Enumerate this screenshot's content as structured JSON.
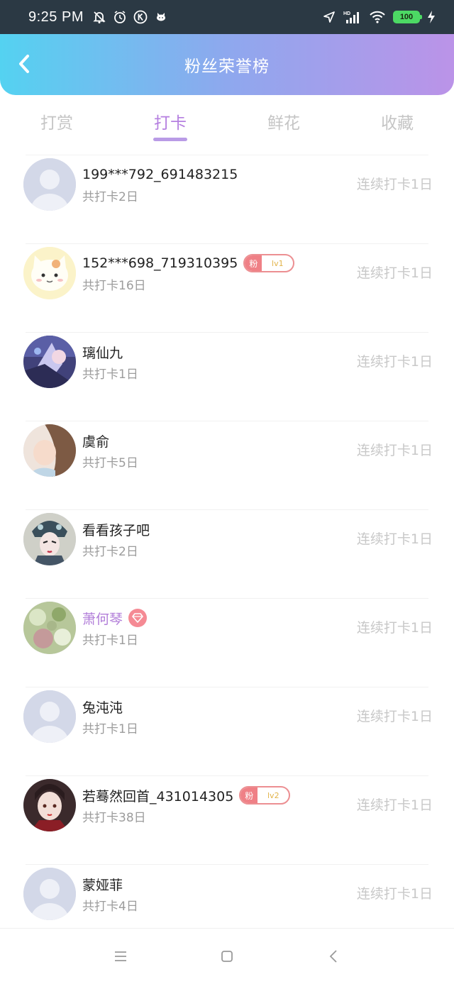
{
  "status_bar": {
    "time": "9:25 PM",
    "battery": "100",
    "icons": [
      "mute-bell-icon",
      "alarm-icon",
      "k-app-icon",
      "cat-app-icon",
      "location-icon",
      "hd-signal-icon",
      "wifi-icon",
      "battery-icon",
      "charging-icon"
    ]
  },
  "header": {
    "title": "粉丝荣誉榜",
    "back_icon": "back-arrow-icon",
    "gradient": [
      "#54d2f1",
      "#bb93e8"
    ]
  },
  "tabs": [
    {
      "label": "打赏",
      "active": false
    },
    {
      "label": "打卡",
      "active": true
    },
    {
      "label": "鲜花",
      "active": false
    },
    {
      "label": "收藏",
      "active": false
    }
  ],
  "accent_color": "#b57fe0",
  "fans": [
    {
      "name": "199***792_691483215",
      "sub": "共打卡2日",
      "right": "连续打卡1日",
      "avatar": "default-avatar"
    },
    {
      "name": "152***698_719310395",
      "sub": "共打卡16日",
      "right": "连续打卡1日",
      "avatar": "cat-avatar",
      "badge": {
        "tag": "粉",
        "level": "lv1"
      }
    },
    {
      "name": "璃仙九",
      "sub": "共打卡1日",
      "right": "连续打卡1日",
      "avatar": "anime-avatar"
    },
    {
      "name": "虞俞",
      "sub": "共打卡5日",
      "right": "连续打卡1日",
      "avatar": "photo-avatar"
    },
    {
      "name": "看看孩子吧",
      "sub": "共打卡2日",
      "right": "连续打卡1日",
      "avatar": "opera-avatar"
    },
    {
      "name": "萧何琴",
      "sub": "共打卡1日",
      "right": "连续打卡1日",
      "avatar": "flower-avatar",
      "vip": true
    },
    {
      "name": "兔沌沌",
      "sub": "共打卡1日",
      "right": "连续打卡1日",
      "avatar": "default-avatar"
    },
    {
      "name": "若蓦然回首_431014305",
      "sub": "共打卡38日",
      "right": "连续打卡1日",
      "avatar": "girl-avatar",
      "badge": {
        "tag": "粉",
        "level": "lv2"
      }
    },
    {
      "name": "蒙娅菲",
      "sub": "共打卡4日",
      "right": "连续打卡1日",
      "avatar": "default-avatar"
    }
  ],
  "nav_bar": {
    "icons": [
      "menu-icon",
      "home-icon",
      "back-icon"
    ]
  }
}
